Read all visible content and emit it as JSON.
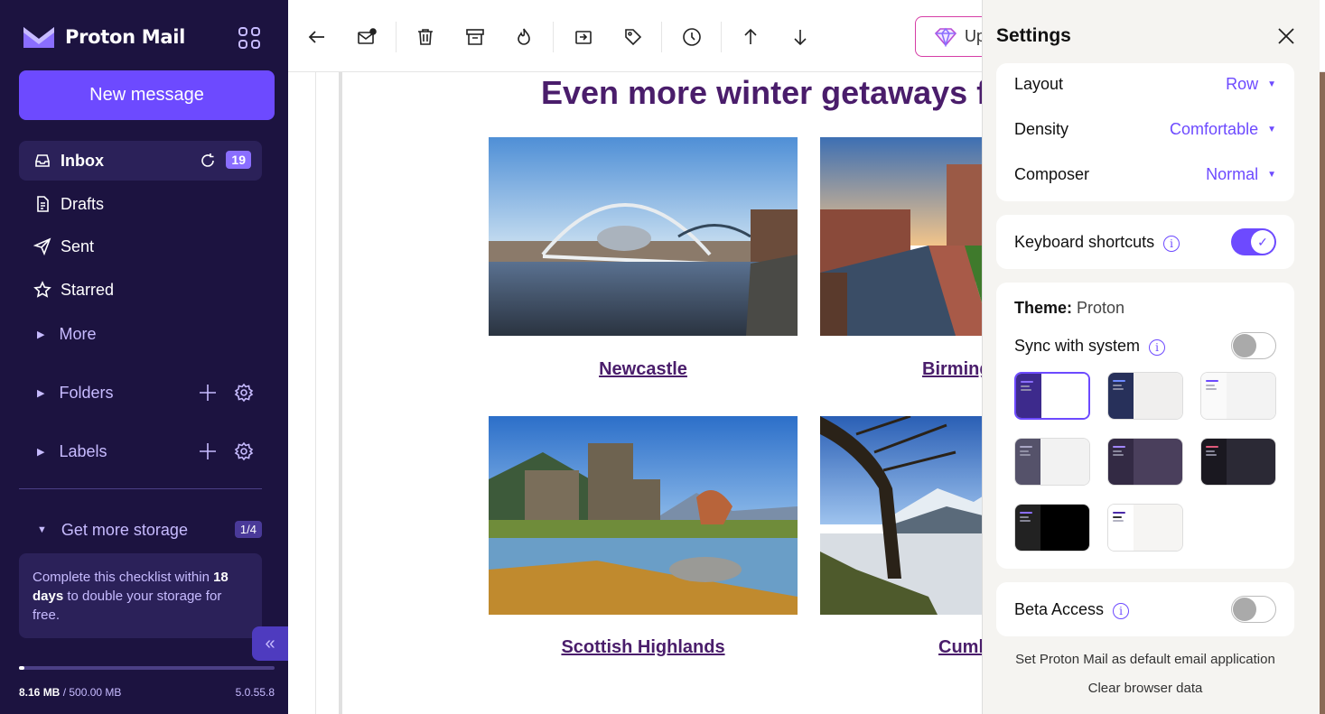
{
  "sidebar": {
    "brand": "Proton Mail",
    "new_message": "New message",
    "items": [
      {
        "label": "Inbox",
        "count": "19"
      },
      {
        "label": "Drafts"
      },
      {
        "label": "Sent"
      },
      {
        "label": "Starred"
      }
    ],
    "more": "More",
    "folders": "Folders",
    "labels": "Labels",
    "storage": {
      "title": "Get more storage",
      "progress": "1/4",
      "checklist_pre": "Complete this checklist within ",
      "checklist_days": "18 days",
      "checklist_post": " to double your storage for free.",
      "used": "8.16 MB",
      "total": " / 500.00 MB",
      "used_fraction": 0.016
    },
    "version": "5.0.55.8"
  },
  "toolbar": {
    "upgrade": "Up"
  },
  "email": {
    "headline": "Even more winter getaways fo",
    "captions": [
      "Newcastle",
      "Birming",
      "Scottish Highlands",
      "Cumb"
    ]
  },
  "settings": {
    "title": "Settings",
    "layout_label": "Layout",
    "layout_value": "Row",
    "density_label": "Density",
    "density_value": "Comfortable",
    "composer_label": "Composer",
    "composer_value": "Normal",
    "shortcuts_label": "Keyboard shortcuts",
    "shortcuts_on": true,
    "theme_label": "Theme:",
    "theme_value": "Proton",
    "sync_label": "Sync with system",
    "sync_on": false,
    "beta_label": "Beta Access",
    "beta_on": false,
    "default_app": "Set Proton Mail as default email application",
    "clear_data": "Clear browser data",
    "colors": {
      "accent": "#6d4aff",
      "sidebar_bg": "#1c1340",
      "headline": "#4a1d6b"
    }
  }
}
